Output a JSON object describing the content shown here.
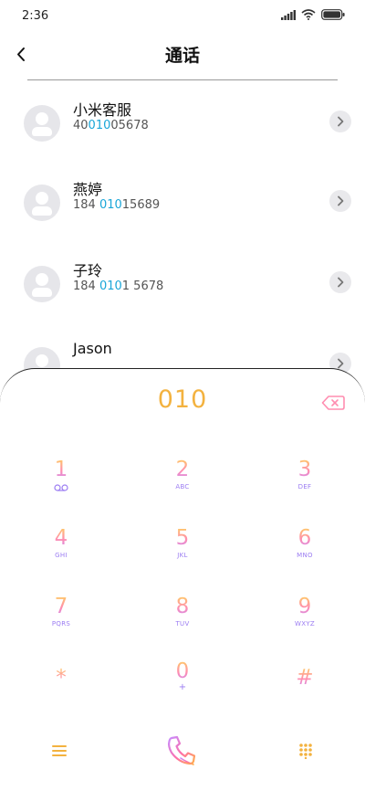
{
  "status_bar": {
    "time": "2:36"
  },
  "header": {
    "title": "通话"
  },
  "contacts": [
    {
      "name": "小米客服",
      "number_pre": "40",
      "number_match": "010",
      "number_post": "05678"
    },
    {
      "name": "燕婷",
      "number_pre": "184 ",
      "number_match": "010",
      "number_post": "15689"
    },
    {
      "name": "子玲",
      "number_pre": "184 ",
      "number_match": "010",
      "number_post": "1 5678"
    },
    {
      "name": "Jason",
      "number_pre": "",
      "number_match": "",
      "number_post": ""
    }
  ],
  "dialpad": {
    "entered": "010",
    "keys": [
      {
        "digit": "1",
        "letters": ""
      },
      {
        "digit": "2",
        "letters": "ABC"
      },
      {
        "digit": "3",
        "letters": "DEF"
      },
      {
        "digit": "4",
        "letters": "GHI"
      },
      {
        "digit": "5",
        "letters": "JKL"
      },
      {
        "digit": "6",
        "letters": "MNO"
      },
      {
        "digit": "7",
        "letters": "PQRS"
      },
      {
        "digit": "8",
        "letters": "TUV"
      },
      {
        "digit": "9",
        "letters": "WXYZ"
      },
      {
        "digit": "*",
        "letters": ""
      },
      {
        "digit": "0",
        "letters": "+"
      },
      {
        "digit": "#",
        "letters": ""
      }
    ]
  },
  "icons": {
    "back": "chevron-left-icon",
    "backspace": "backspace-icon",
    "menu": "menu-icon",
    "call": "phone-call-icon",
    "keypad": "keypad-grid-icon"
  },
  "colors": {
    "accent_orange": "#f3b23f",
    "match_blue": "#1aa6d8",
    "letters_purple": "#9b7cf2"
  }
}
